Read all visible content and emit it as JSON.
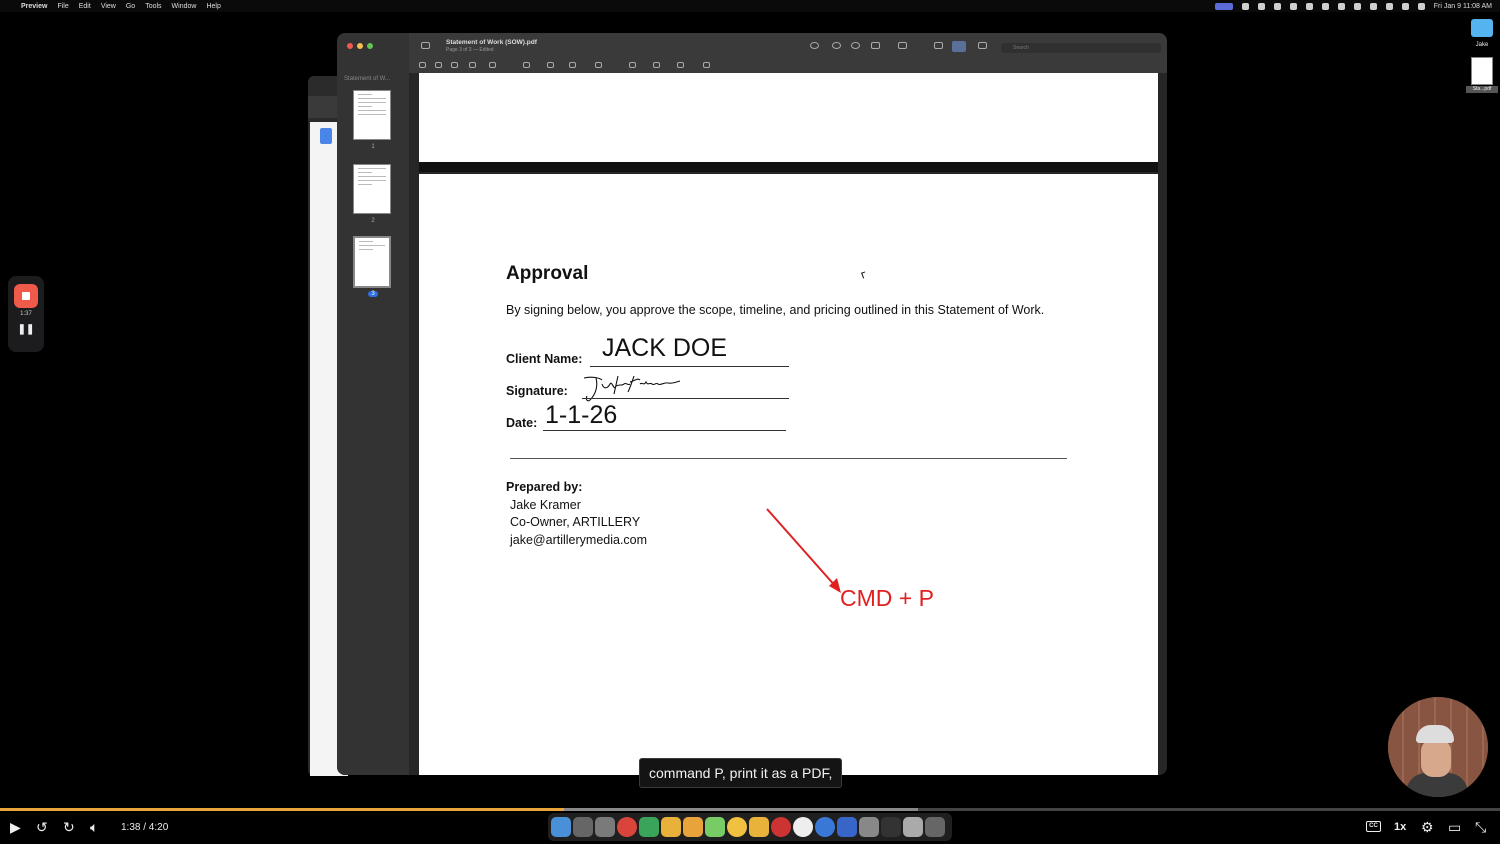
{
  "menubar": {
    "app": "Preview",
    "items": [
      "File",
      "Edit",
      "View",
      "Go",
      "Tools",
      "Window",
      "Help"
    ],
    "clock": "Fri Jan 9  11:08 AM"
  },
  "desktop": {
    "folder_label": "Jake",
    "file_label": "Sta...pdf"
  },
  "recorder": {
    "time": "1:37"
  },
  "preview": {
    "title": "Statement of Work (SOW).pdf",
    "subtitle": "Page 3 of 3 — Edited",
    "sidebar_title": "Statement of W...",
    "search_placeholder": "Search",
    "pages": [
      {
        "number": "1"
      },
      {
        "number": "2"
      },
      {
        "number": "3"
      }
    ]
  },
  "document": {
    "heading": "Approval",
    "intro": "By signing below, you approve the scope, timeline, and pricing outlined in this Statement of Work.",
    "client_label": "Client Name:",
    "client_value": "JACK DOE",
    "signature_label": "Signature:",
    "date_label": "Date:",
    "date_value": "1-1-26",
    "prepared_label": "Prepared by:",
    "prepared_lines": [
      "Jake Kramer",
      "Co-Owner, ARTILLERY",
      "jake@artillerymedia.com"
    ],
    "annotation": "CMD + P"
  },
  "caption": "command P, print it as a PDF,",
  "player": {
    "time": "1:38 / 4:20",
    "speed": "1x",
    "cc_label": "CC",
    "progress_fraction": 0.376,
    "buffered_fraction": 0.612,
    "progress_color": "#e9a53a"
  },
  "colors": {
    "annotation": "#e02020",
    "recorder_stop": "#f05a4a",
    "selected_page": "#2f6fe0"
  }
}
